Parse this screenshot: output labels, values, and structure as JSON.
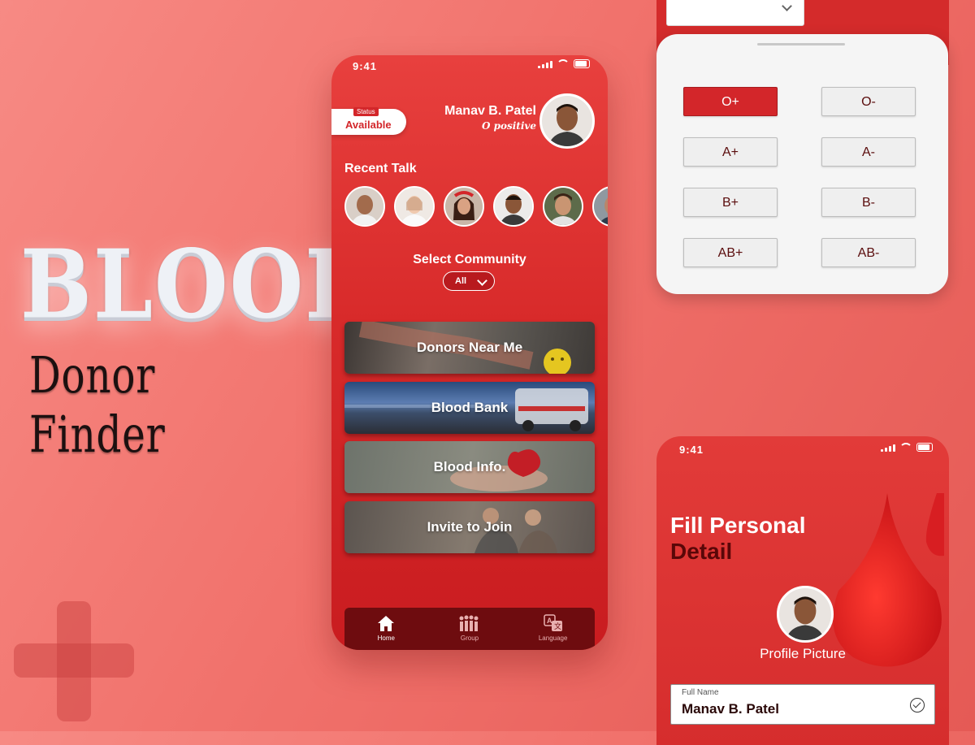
{
  "hero": {
    "title": "BLOOD",
    "subtitle": "Donor Finder"
  },
  "main_phone": {
    "time": "9:41",
    "status_tag": "Status",
    "status_value": "Available",
    "user_name": "Manav B. Patel",
    "user_blood": "O positive",
    "recent_talk_title": "Recent Talk",
    "select_community_title": "Select Community",
    "community_value": "All",
    "cards": [
      {
        "label": "Donors Near Me"
      },
      {
        "label": "Blood Bank"
      },
      {
        "label": "Blood Info."
      },
      {
        "label": "Invite to Join"
      }
    ],
    "tabs": [
      {
        "label": "Home",
        "icon": "home-icon"
      },
      {
        "label": "Group",
        "icon": "group-icon"
      },
      {
        "label": "Language",
        "icon": "language-icon"
      }
    ]
  },
  "blood_groups": {
    "selected": "O+",
    "options": [
      "O+",
      "O-",
      "A+",
      "A-",
      "B+",
      "B-",
      "AB+",
      "AB-"
    ]
  },
  "profile_phone": {
    "time": "9:41",
    "title_line1": "Fill Personal",
    "title_line2": "Detail",
    "profile_picture_label": "Profile Picture",
    "full_name_label": "Full Name",
    "full_name_value": "Manav B. Patel"
  },
  "colors": {
    "primary_red": "#d3262a",
    "dark_red": "#6e0c0f",
    "background": "#f1726c"
  }
}
